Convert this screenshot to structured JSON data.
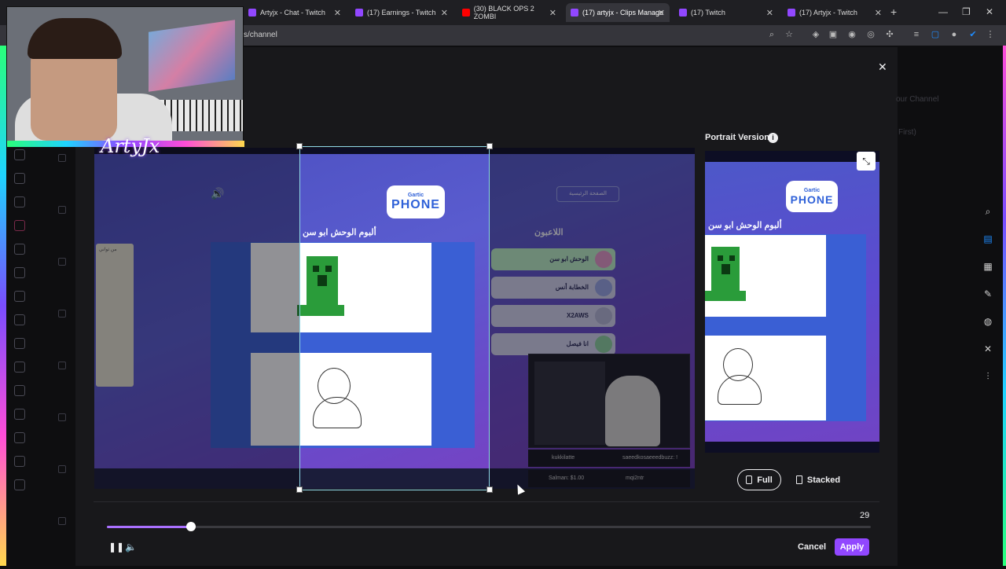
{
  "browser": {
    "tabs": [
      {
        "label": "Artyjx - Chat - Twitch",
        "active": false
      },
      {
        "label": "(17) Earnings - Twitch",
        "active": false
      },
      {
        "label": "(30) BLACK OPS 2 ZOMBI",
        "active": false
      },
      {
        "label": "(17) artyjx - Clips Manage",
        "active": true
      },
      {
        "label": "(17) Twitch",
        "active": false
      },
      {
        "label": "(17) Artyjx - Twitch",
        "active": false
      }
    ],
    "url": "s/channel",
    "new_tab": "+"
  },
  "background": {
    "channel_text": "our Channel",
    "filter_text": "First)"
  },
  "stream": {
    "streamer_name": "ArtyJx"
  },
  "preview": {
    "logo_small": "Gartic",
    "logo_big": "PHONE",
    "album_title": "ألبوم الوحش ابو سن",
    "players_title": "اللاعبون",
    "home_button": "الصفحة الرئيسية",
    "players": [
      "الوحش ابو سن",
      "الخطابة أنس",
      "X2AWS",
      "انا فيصل"
    ],
    "chat_lines": [
      "kukkilatte",
      "saeedkosaeeedbuzz: !",
      "Salman: $1.00",
      "mqi2ntr"
    ],
    "side_chat": "من ثواني"
  },
  "portrait": {
    "label": "Portrait Version",
    "info_icon": "i",
    "album_title": "ألبوم الوحش ابو سن",
    "logo_small": "Gartic",
    "logo_big": "PHONE"
  },
  "layout_options": {
    "full_label": "Full",
    "stacked_label": "Stacked",
    "selected": "Full"
  },
  "timeline": {
    "time_value": "29",
    "progress": 0.11
  },
  "actions": {
    "cancel_label": "Cancel",
    "apply_label": "Apply"
  },
  "colors": {
    "accent": "#9147ff",
    "crop_frame": "#8fd8e8"
  }
}
